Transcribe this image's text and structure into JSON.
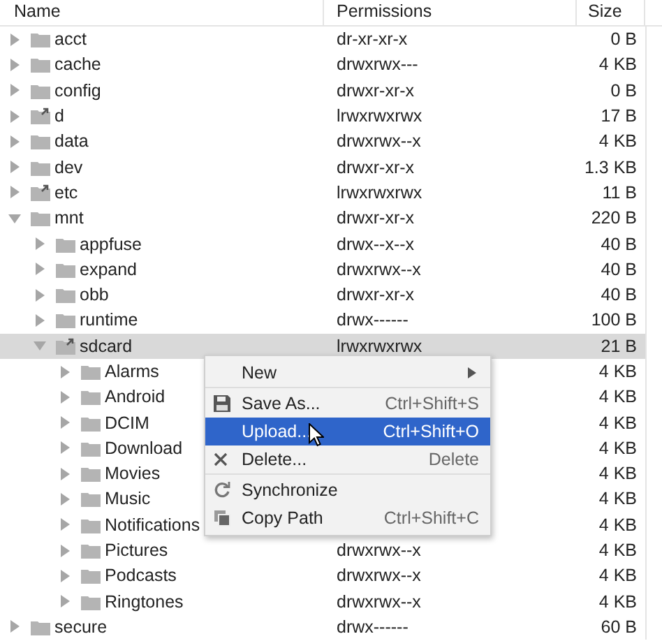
{
  "columns": [
    "Name",
    "Permissions",
    "Size"
  ],
  "tree": [
    {
      "name": "acct",
      "kind": "folder",
      "permissions": "dr-xr-xr-x",
      "size": "0 B",
      "expanded": false,
      "selected": false
    },
    {
      "name": "cache",
      "kind": "folder",
      "permissions": "drwxrwx---",
      "size": "4 KB",
      "expanded": false,
      "selected": false
    },
    {
      "name": "config",
      "kind": "folder",
      "permissions": "drwxr-xr-x",
      "size": "0 B",
      "expanded": false,
      "selected": false
    },
    {
      "name": "d",
      "kind": "link",
      "permissions": "lrwxrwxrwx",
      "size": "17 B",
      "expanded": false,
      "selected": false
    },
    {
      "name": "data",
      "kind": "folder",
      "permissions": "drwxrwx--x",
      "size": "4 KB",
      "expanded": false,
      "selected": false
    },
    {
      "name": "dev",
      "kind": "folder",
      "permissions": "drwxr-xr-x",
      "size": "1.3 KB",
      "expanded": false,
      "selected": false
    },
    {
      "name": "etc",
      "kind": "link",
      "permissions": "lrwxrwxrwx",
      "size": "11 B",
      "expanded": false,
      "selected": false
    },
    {
      "name": "mnt",
      "kind": "folder",
      "permissions": "drwxr-xr-x",
      "size": "220 B",
      "expanded": true,
      "selected": false,
      "children": [
        {
          "name": "appfuse",
          "kind": "folder",
          "permissions": "drwx--x--x",
          "size": "40 B",
          "expanded": false,
          "selected": false
        },
        {
          "name": "expand",
          "kind": "folder",
          "permissions": "drwxrwx--x",
          "size": "40 B",
          "expanded": false,
          "selected": false
        },
        {
          "name": "obb",
          "kind": "folder",
          "permissions": "drwxr-xr-x",
          "size": "40 B",
          "expanded": false,
          "selected": false
        },
        {
          "name": "runtime",
          "kind": "folder",
          "permissions": "drwx------",
          "size": "100 B",
          "expanded": false,
          "selected": false
        },
        {
          "name": "sdcard",
          "kind": "link",
          "permissions": "lrwxrwxrwx",
          "size": "21 B",
          "expanded": true,
          "selected": true,
          "children": [
            {
              "name": "Alarms",
              "kind": "folder",
              "size": "4 KB",
              "expanded": false,
              "selected": false
            },
            {
              "name": "Android",
              "kind": "folder",
              "size": "4 KB",
              "expanded": false,
              "selected": false
            },
            {
              "name": "DCIM",
              "kind": "folder",
              "size": "4 KB",
              "expanded": false,
              "selected": false
            },
            {
              "name": "Download",
              "kind": "folder",
              "size": "4 KB",
              "expanded": false,
              "selected": false
            },
            {
              "name": "Movies",
              "kind": "folder",
              "size": "4 KB",
              "expanded": false,
              "selected": false
            },
            {
              "name": "Music",
              "kind": "folder",
              "size": "4 KB",
              "expanded": false,
              "selected": false
            },
            {
              "name": "Notifications",
              "kind": "folder",
              "size": "4 KB",
              "expanded": false,
              "selected": false
            },
            {
              "name": "Pictures",
              "kind": "folder",
              "permissions": "drwxrwx--x",
              "size": "4 KB",
              "expanded": false,
              "selected": false
            },
            {
              "name": "Podcasts",
              "kind": "folder",
              "permissions": "drwxrwx--x",
              "size": "4 KB",
              "expanded": false,
              "selected": false
            },
            {
              "name": "Ringtones",
              "kind": "folder",
              "permissions": "drwxrwx--x",
              "size": "4 KB",
              "expanded": false,
              "selected": false
            }
          ]
        }
      ]
    },
    {
      "name": "secure",
      "kind": "folder",
      "permissions": "drwx------",
      "size": "60 B",
      "expanded": false,
      "selected": false
    }
  ],
  "context_menu": [
    {
      "label": "New",
      "kind": "plain",
      "submenu": true,
      "selected": false,
      "separator_after": true
    },
    {
      "label": "Save As...",
      "kind": "save",
      "submenu": false,
      "shortcut": "Ctrl+Shift+S",
      "selected": false,
      "separator_after": false
    },
    {
      "label": "Upload...",
      "kind": "plain",
      "submenu": false,
      "shortcut": "Ctrl+Shift+O",
      "selected": true,
      "separator_after": false
    },
    {
      "label": "Delete...",
      "kind": "delete",
      "submenu": false,
      "shortcut": "Delete",
      "selected": false,
      "separator_after": true
    },
    {
      "label": "Synchronize",
      "kind": "sync",
      "submenu": false,
      "selected": false,
      "separator_after": false
    },
    {
      "label": "Copy Path",
      "kind": "copy",
      "submenu": false,
      "shortcut": "Ctrl+Shift+C",
      "selected": false,
      "separator_after": false
    }
  ]
}
